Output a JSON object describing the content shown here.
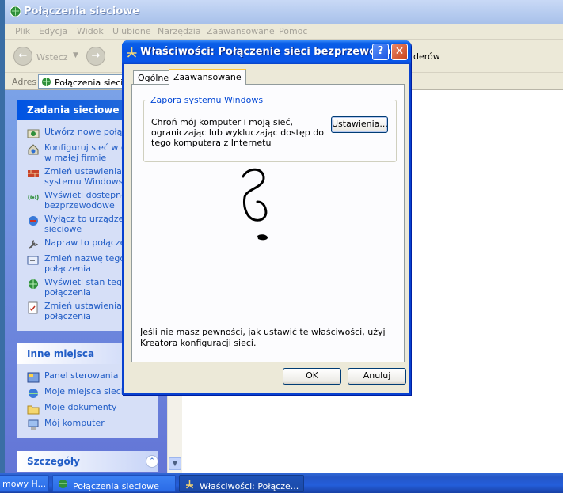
{
  "explorer": {
    "title": "Połączenia sieciowe",
    "menu": [
      "Plik",
      "Edycja",
      "Widok",
      "Ulubione",
      "Narzędzia",
      "Zaawansowane",
      "Pomoc"
    ],
    "toolbar": {
      "back_label": "Wstecz",
      "right_fragment": "derów"
    },
    "address": {
      "label": "Adres",
      "value": "Połączenia sieciow"
    }
  },
  "taskpane": {
    "network_tasks": {
      "title": "Zadania sieciowe",
      "items": [
        {
          "label": "Utwórz nowe połącze",
          "icon": "new-connection-icon"
        },
        {
          "label": "Konfiguruj sieć w do lub w małej firmie",
          "icon": "home-network-icon"
        },
        {
          "label": "Zmień ustawienia Za systemu Windows",
          "icon": "firewall-icon"
        },
        {
          "label": "Wyświetl dostępne s bezprzewodowe",
          "icon": "wireless-icon"
        },
        {
          "label": "Wyłącz to urządzen sieciowe",
          "icon": "disable-device-icon"
        },
        {
          "label": "Napraw to połączen",
          "icon": "repair-icon"
        },
        {
          "label": "Zmień nazwę tego połączenia",
          "icon": "rename-icon"
        },
        {
          "label": "Wyświetl stan tego połączenia",
          "icon": "status-icon"
        },
        {
          "label": "Zmień ustawienia te połączenia",
          "icon": "settings-icon"
        }
      ]
    },
    "other_places": {
      "title": "Inne miejsca",
      "items": [
        {
          "label": "Panel sterowania",
          "icon": "control-panel-icon"
        },
        {
          "label": "Moje miejsca sieciow",
          "icon": "network-places-icon"
        },
        {
          "label": "Moje dokumenty",
          "icon": "documents-icon"
        },
        {
          "label": "Mój komputer",
          "icon": "computer-icon"
        }
      ]
    },
    "details": {
      "title": "Szczegóły"
    }
  },
  "taskbar": {
    "items": [
      {
        "label": "mowy H..."
      },
      {
        "label": "Połączenia sieciowe"
      },
      {
        "label": "Właściwości: Połącze..."
      }
    ]
  },
  "dialog": {
    "title": "Właściwości: Połączenie sieci bezprzewodo...",
    "help_label": "?",
    "close_label": "✕",
    "tabs": [
      "Ogólne",
      "Zaawansowane"
    ],
    "active_tab": "Zaawansowane",
    "firewall_group": {
      "title": "Zapora systemu Windows",
      "description": "Chroń mój komputer i moją sieć, ograniczając lub wykluczając dostęp do tego komputera z Internetu",
      "button_label": "Ustawienia..."
    },
    "note_prefix": "Jeśli nie masz pewności, jak ustawić te właściwości, użyj ",
    "note_link": "Kreatora konfiguracji sieci",
    "note_suffix": ".",
    "ok_label": "OK",
    "cancel_label": "Anuluj"
  },
  "colors": {
    "xp_blue": "#0054e3",
    "taskpane_link": "#215dc6",
    "group_title": "#0046d5",
    "tab_highlight": "#ffc83c"
  }
}
